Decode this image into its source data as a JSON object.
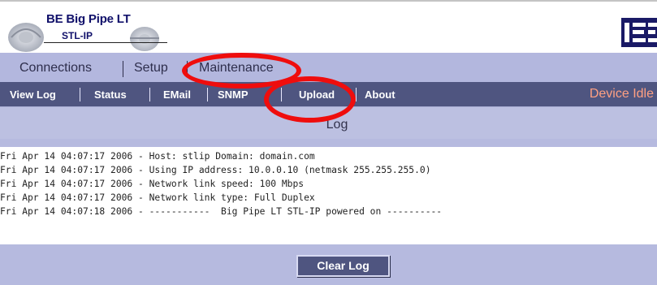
{
  "header": {
    "product_name": "BE Big Pipe LT",
    "product_sub": "STL-IP",
    "brand_logo_text": "BE"
  },
  "menu": {
    "items": [
      {
        "label": "Connections"
      },
      {
        "label": "Setup"
      },
      {
        "label": "Maintenance"
      }
    ]
  },
  "subnav": {
    "items": [
      {
        "label": "View Log"
      },
      {
        "label": "Status"
      },
      {
        "label": "EMail"
      },
      {
        "label": "SNMP"
      },
      {
        "label": "Upload"
      },
      {
        "label": "About"
      }
    ],
    "device_status": "Device Idle"
  },
  "log": {
    "title": "Log",
    "lines": [
      "Fri Apr 14 04:07:17 2006 - Host: stlip Domain: domain.com",
      "Fri Apr 14 04:07:17 2006 - Using IP address: 10.0.0.10 (netmask 255.255.255.0)",
      "Fri Apr 14 04:07:17 2006 - Network link speed: 100 Mbps",
      "Fri Apr 14 04:07:17 2006 - Network link type: Full Duplex",
      "Fri Apr 14 04:07:18 2006 - -----------  Big Pipe LT STL-IP powered on ----------"
    ],
    "clear_button": "Clear Log"
  },
  "colors": {
    "menu_bar": "#b3b7de",
    "subnav_bar": "#4f5580",
    "content_bg": "#b6badf",
    "device_status": "#ffa082",
    "annotation": "#ef0d0d"
  }
}
